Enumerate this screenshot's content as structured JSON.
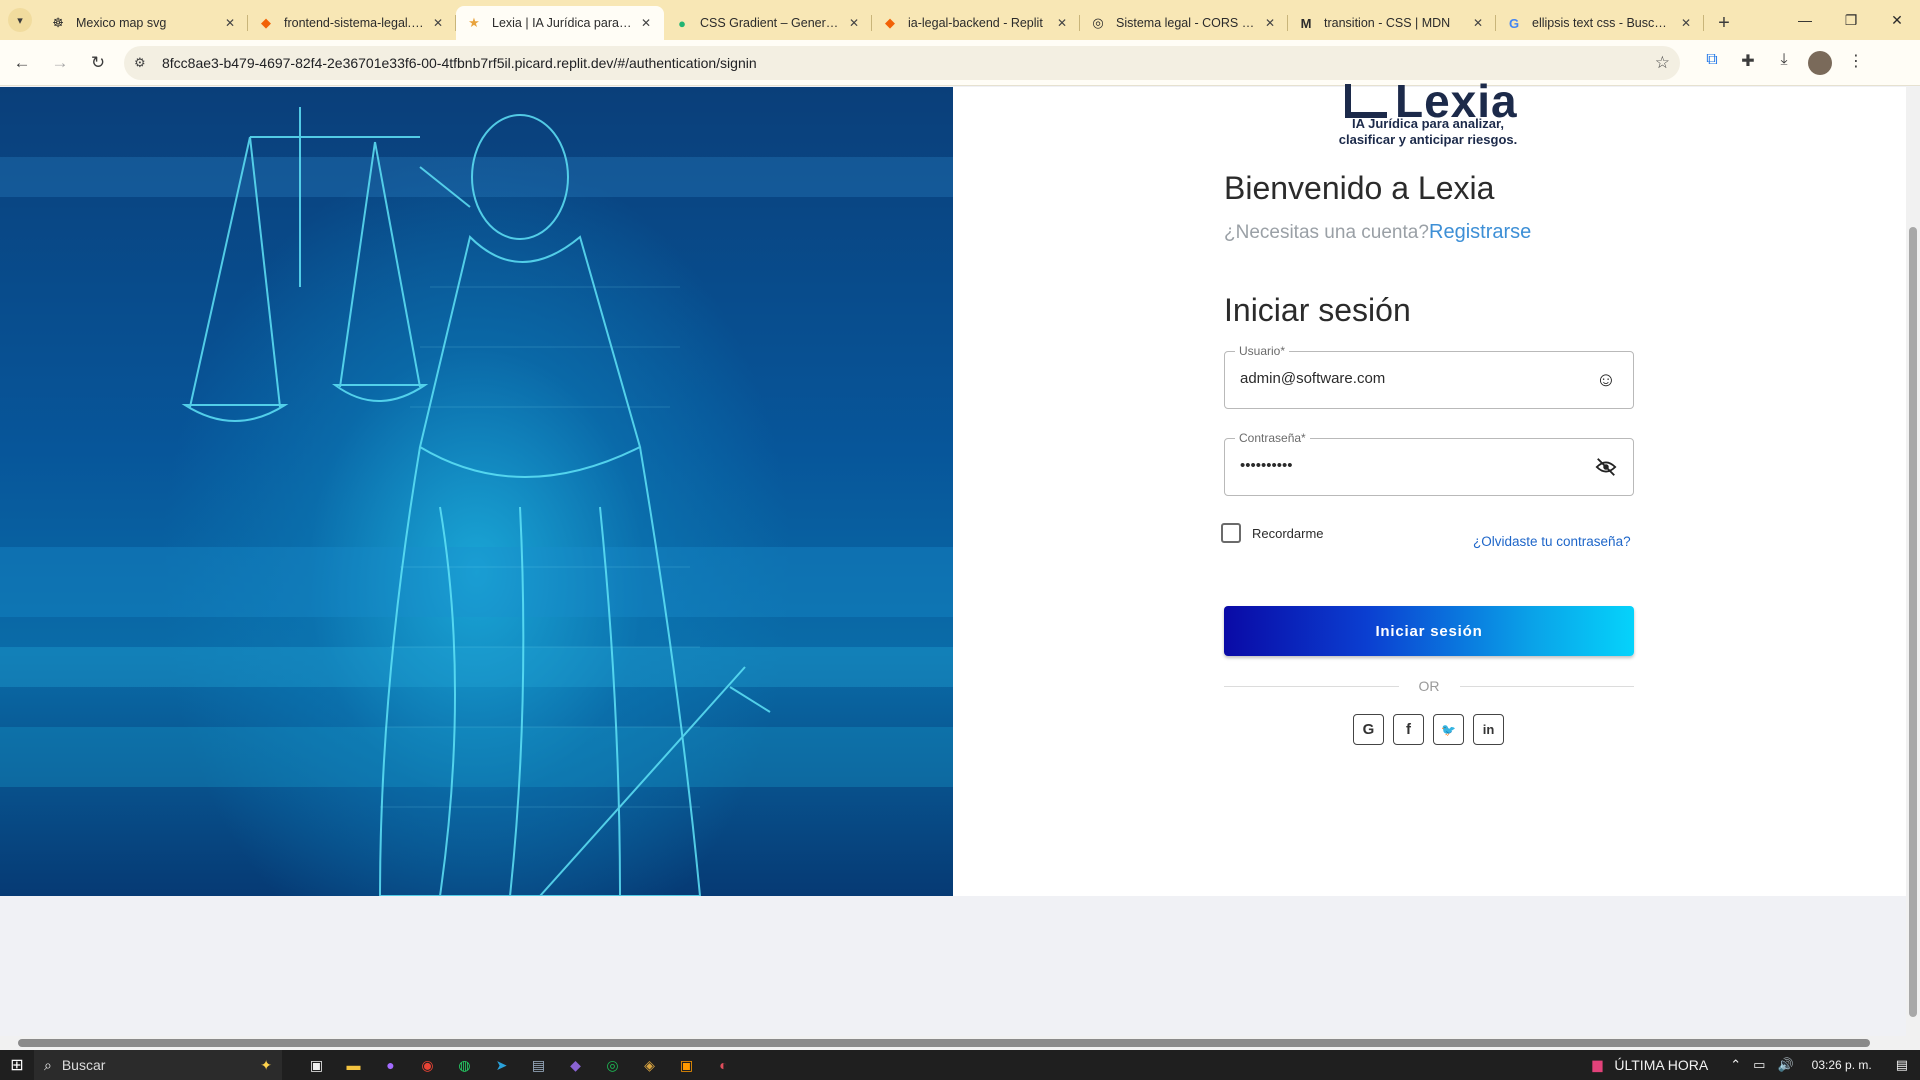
{
  "browser": {
    "tabs": [
      {
        "title": "Mexico map svg",
        "favicon": "☸",
        "favicon_color": "#222222",
        "active": false
      },
      {
        "title": "frontend-sistema-legal. - Replit",
        "favicon": "◆",
        "favicon_color": "#f26207",
        "active": false
      },
      {
        "title": "Lexia | IA Jurídica para analizar",
        "favicon": "★",
        "favicon_color": "#e8a33d",
        "active": true
      },
      {
        "title": "CSS Gradient – Generator",
        "favicon": "●",
        "favicon_color": "#22b573",
        "active": false
      },
      {
        "title": "ia-legal-backend - Replit",
        "favicon": "◆",
        "favicon_color": "#f26207",
        "active": false
      },
      {
        "title": "Sistema legal - CORS Error",
        "favicon": "◎",
        "favicon_color": "#222222",
        "active": false
      },
      {
        "title": "transition - CSS | MDN",
        "favicon": "M",
        "favicon_color": "#111111",
        "active": false
      },
      {
        "title": "ellipsis text css - Buscar con Google",
        "favicon": "G",
        "favicon_color": "#4285f4",
        "active": false
      }
    ],
    "url": "8fcc8ae3-b479-4697-82f4-2e36701e33f6-00-4tfbnb7rf5il.picard.replit.dev/#/authentication/signin"
  },
  "brand": {
    "name": "Lexia",
    "tagline_line1": "IA Jurídica para analizar,",
    "tagline_line2": "clasificar y anticipar riesgos."
  },
  "auth": {
    "welcome": "Bienvenido a Lexia",
    "need_account": "¿Necesitas una cuenta?",
    "register": "Registrarse",
    "title": "Iniciar sesión",
    "username_label": "Usuario*",
    "username_value": "admin@software.com",
    "password_label": "Contraseña*",
    "password_value": "••••••••••",
    "remember": "Recordarme",
    "remember_checked": false,
    "forgot": "¿Olvidaste tu contraseña?",
    "submit": "Iniciar sesión",
    "divider": "OR",
    "socials": [
      {
        "name": "google",
        "glyph": "G"
      },
      {
        "name": "facebook",
        "glyph": "f"
      },
      {
        "name": "twitter",
        "glyph": "🐦"
      },
      {
        "name": "linkedin",
        "glyph": "in"
      }
    ]
  },
  "taskbar": {
    "search": "Buscar",
    "news": "ÚLTIMA HORA",
    "time": "03:26 p. m."
  },
  "colors": {
    "accent_link": "#3d8fd6",
    "button_gradient_start": "#0a0aa6",
    "button_gradient_end": "#05d3fb",
    "brand_navy": "#1c2a4a",
    "tab_strip": "#f8e7b5"
  }
}
